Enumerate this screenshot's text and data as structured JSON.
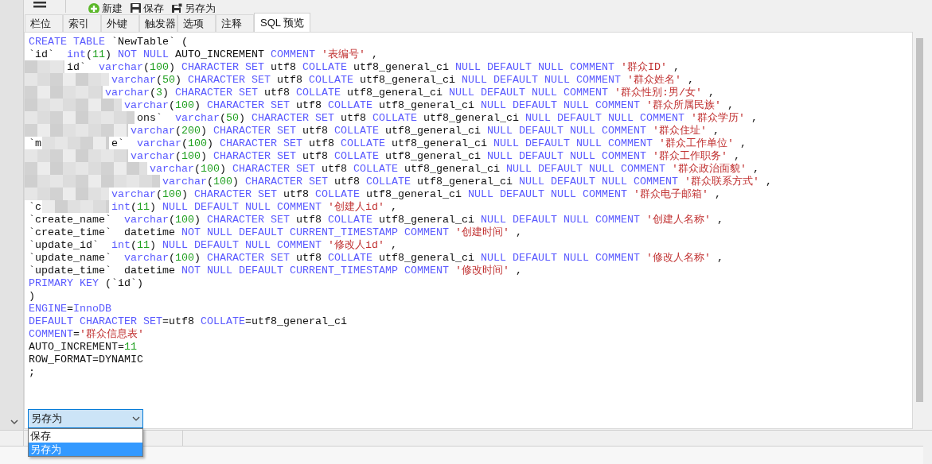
{
  "toolbar": {
    "items": [
      {
        "label": "新建",
        "kind": "new"
      },
      {
        "label": "保存",
        "kind": "save"
      },
      {
        "label": "另存为",
        "kind": "saveas"
      }
    ]
  },
  "tabs": [
    {
      "label": "栏位",
      "selected": false
    },
    {
      "label": "索引",
      "selected": false
    },
    {
      "label": "外键",
      "selected": false
    },
    {
      "label": "触发器",
      "selected": false
    },
    {
      "label": "选项",
      "selected": false
    },
    {
      "label": "注释",
      "selected": false
    },
    {
      "label": "SQL 预览",
      "selected": true
    }
  ],
  "sql_lines": [
    {
      "tokens": [
        {
          "kind": "kw",
          "text": "CREATE TABLE"
        },
        {
          "kind": "id",
          "text": " `NewTable` ("
        }
      ]
    },
    {
      "tokens": [
        {
          "kind": "id",
          "text": "`id`  "
        },
        {
          "kind": "kw",
          "text": "int"
        },
        {
          "kind": "id",
          "text": "("
        },
        {
          "kind": "num",
          "text": "11"
        },
        {
          "kind": "id",
          "text": ") "
        },
        {
          "kind": "kw",
          "text": "NOT NULL"
        },
        {
          "kind": "id",
          "text": " AUTO_INCREMENT "
        },
        {
          "kind": "kw",
          "text": "COMMENT"
        },
        {
          "kind": "str",
          "text": " '表编号'"
        },
        {
          "kind": "id",
          "text": " ,"
        }
      ]
    },
    {
      "tokens": [
        {
          "kind": "id",
          "text": "id`  "
        },
        {
          "kind": "kw",
          "text": "varchar"
        },
        {
          "kind": "id",
          "text": "("
        },
        {
          "kind": "num",
          "text": "100"
        },
        {
          "kind": "id",
          "text": ") "
        },
        {
          "kind": "kw",
          "text": "CHARACTER SET"
        },
        {
          "kind": "id",
          "text": " utf8 "
        },
        {
          "kind": "kw",
          "text": "COLLATE"
        },
        {
          "kind": "id",
          "text": " utf8_general_ci "
        },
        {
          "kind": "kw",
          "text": "NULL DEFAULT NULL COMMENT"
        },
        {
          "kind": "str",
          "text": " '群众ID'"
        },
        {
          "kind": "id",
          "text": " ,"
        }
      ]
    },
    {
      "tokens": [
        {
          "kind": "kw",
          "text": "varchar"
        },
        {
          "kind": "id",
          "text": "("
        },
        {
          "kind": "num",
          "text": "50"
        },
        {
          "kind": "id",
          "text": ") "
        },
        {
          "kind": "kw",
          "text": "CHARACTER SET"
        },
        {
          "kind": "id",
          "text": " utf8 "
        },
        {
          "kind": "kw",
          "text": "COLLATE"
        },
        {
          "kind": "id",
          "text": " utf8_general_ci "
        },
        {
          "kind": "kw",
          "text": "NULL DEFAULT NULL COMMENT"
        },
        {
          "kind": "str",
          "text": " '群众姓名'"
        },
        {
          "kind": "id",
          "text": " ,"
        }
      ]
    },
    {
      "tokens": [
        {
          "kind": "kw",
          "text": "varchar"
        },
        {
          "kind": "id",
          "text": "("
        },
        {
          "kind": "num",
          "text": "3"
        },
        {
          "kind": "id",
          "text": ") "
        },
        {
          "kind": "kw",
          "text": "CHARACTER SET"
        },
        {
          "kind": "id",
          "text": " utf8 "
        },
        {
          "kind": "kw",
          "text": "COLLATE"
        },
        {
          "kind": "id",
          "text": " utf8_general_ci "
        },
        {
          "kind": "kw",
          "text": "NULL DEFAULT NULL COMMENT"
        },
        {
          "kind": "str",
          "text": " '群众性别:男/女'"
        },
        {
          "kind": "id",
          "text": " ,"
        }
      ]
    },
    {
      "tokens": [
        {
          "kind": "kw",
          "text": "varchar"
        },
        {
          "kind": "id",
          "text": "("
        },
        {
          "kind": "num",
          "text": "100"
        },
        {
          "kind": "id",
          "text": ") "
        },
        {
          "kind": "kw",
          "text": "CHARACTER SET"
        },
        {
          "kind": "id",
          "text": " utf8 "
        },
        {
          "kind": "kw",
          "text": "COLLATE"
        },
        {
          "kind": "id",
          "text": " utf8_general_ci "
        },
        {
          "kind": "kw",
          "text": "NULL DEFAULT NULL COMMENT"
        },
        {
          "kind": "str",
          "text": " '群众所属民族'"
        },
        {
          "kind": "id",
          "text": " ,"
        }
      ]
    },
    {
      "tokens": [
        {
          "kind": "id",
          "text": "ons`  "
        },
        {
          "kind": "kw",
          "text": "varchar"
        },
        {
          "kind": "id",
          "text": "("
        },
        {
          "kind": "num",
          "text": "50"
        },
        {
          "kind": "id",
          "text": ") "
        },
        {
          "kind": "kw",
          "text": "CHARACTER SET"
        },
        {
          "kind": "id",
          "text": " utf8 "
        },
        {
          "kind": "kw",
          "text": "COLLATE"
        },
        {
          "kind": "id",
          "text": " utf8_general_ci "
        },
        {
          "kind": "kw",
          "text": "NULL DEFAULT NULL COMMENT"
        },
        {
          "kind": "str",
          "text": " '群众学历'"
        },
        {
          "kind": "id",
          "text": " ,"
        }
      ]
    },
    {
      "tokens": [
        {
          "kind": "kw",
          "text": "varchar"
        },
        {
          "kind": "id",
          "text": "("
        },
        {
          "kind": "num",
          "text": "200"
        },
        {
          "kind": "id",
          "text": ") "
        },
        {
          "kind": "kw",
          "text": "CHARACTER SET"
        },
        {
          "kind": "id",
          "text": " utf8 "
        },
        {
          "kind": "kw",
          "text": "COLLATE"
        },
        {
          "kind": "id",
          "text": " utf8_general_ci "
        },
        {
          "kind": "kw",
          "text": "NULL DEFAULT NULL COMMENT"
        },
        {
          "kind": "str",
          "text": " '群众住址'"
        },
        {
          "kind": "id",
          "text": " ,"
        }
      ]
    },
    {
      "lead": [
        {
          "kind": "id",
          "text": "`m"
        }
      ],
      "tokens": [
        {
          "kind": "id",
          "text": "e`  "
        },
        {
          "kind": "kw",
          "text": "varchar"
        },
        {
          "kind": "id",
          "text": "("
        },
        {
          "kind": "num",
          "text": "100"
        },
        {
          "kind": "id",
          "text": ") "
        },
        {
          "kind": "kw",
          "text": "CHARACTER SET"
        },
        {
          "kind": "id",
          "text": " utf8 "
        },
        {
          "kind": "kw",
          "text": "COLLATE"
        },
        {
          "kind": "id",
          "text": " utf8_general_ci "
        },
        {
          "kind": "kw",
          "text": "NULL DEFAULT NULL COMMENT"
        },
        {
          "kind": "str",
          "text": " '群众工作单位'"
        },
        {
          "kind": "id",
          "text": " ,"
        }
      ]
    },
    {
      "tokens": [
        {
          "kind": "kw",
          "text": "varchar"
        },
        {
          "kind": "id",
          "text": "("
        },
        {
          "kind": "num",
          "text": "100"
        },
        {
          "kind": "id",
          "text": ") "
        },
        {
          "kind": "kw",
          "text": "CHARACTER SET"
        },
        {
          "kind": "id",
          "text": " utf8 "
        },
        {
          "kind": "kw",
          "text": "COLLATE"
        },
        {
          "kind": "id",
          "text": " utf8_general_ci "
        },
        {
          "kind": "kw",
          "text": "NULL DEFAULT NULL COMMENT"
        },
        {
          "kind": "str",
          "text": " '群众工作职务'"
        },
        {
          "kind": "id",
          "text": " ,"
        }
      ]
    },
    {
      "tokens": [
        {
          "kind": "kw",
          "text": "varchar"
        },
        {
          "kind": "id",
          "text": "("
        },
        {
          "kind": "num",
          "text": "100"
        },
        {
          "kind": "id",
          "text": ") "
        },
        {
          "kind": "kw",
          "text": "CHARACTER SET"
        },
        {
          "kind": "id",
          "text": " utf8 "
        },
        {
          "kind": "kw",
          "text": "COLLATE"
        },
        {
          "kind": "id",
          "text": " utf8_general_ci "
        },
        {
          "kind": "kw",
          "text": "NULL DEFAULT NULL COMMENT"
        },
        {
          "kind": "str",
          "text": " '群众政治面貌'"
        },
        {
          "kind": "id",
          "text": " ,"
        }
      ]
    },
    {
      "tokens": [
        {
          "kind": "kw",
          "text": "varchar"
        },
        {
          "kind": "id",
          "text": "("
        },
        {
          "kind": "num",
          "text": "100"
        },
        {
          "kind": "id",
          "text": ") "
        },
        {
          "kind": "kw",
          "text": "CHARACTER SET"
        },
        {
          "kind": "id",
          "text": " utf8 "
        },
        {
          "kind": "kw",
          "text": "COLLATE"
        },
        {
          "kind": "id",
          "text": " utf8_general_ci "
        },
        {
          "kind": "kw",
          "text": "NULL DEFAULT NULL COMMENT"
        },
        {
          "kind": "str",
          "text": " '群众联系方式'"
        },
        {
          "kind": "id",
          "text": " ,"
        }
      ]
    },
    {
      "tokens": [
        {
          "kind": "kw",
          "text": "varchar"
        },
        {
          "kind": "id",
          "text": "("
        },
        {
          "kind": "num",
          "text": "100"
        },
        {
          "kind": "id",
          "text": ") "
        },
        {
          "kind": "kw",
          "text": "CHARACTER SET"
        },
        {
          "kind": "id",
          "text": " utf8 "
        },
        {
          "kind": "kw",
          "text": "COLLATE"
        },
        {
          "kind": "id",
          "text": " utf8_general_ci "
        },
        {
          "kind": "kw",
          "text": "NULL DEFAULT NULL COMMENT"
        },
        {
          "kind": "str",
          "text": " '群众电子邮箱'"
        },
        {
          "kind": "id",
          "text": " ,"
        }
      ]
    },
    {
      "lead": [
        {
          "kind": "id",
          "text": "`c"
        }
      ],
      "tokens": [
        {
          "kind": "kw",
          "text": "int"
        },
        {
          "kind": "id",
          "text": "("
        },
        {
          "kind": "num",
          "text": "11"
        },
        {
          "kind": "id",
          "text": ") "
        },
        {
          "kind": "kw",
          "text": "NULL DEFAULT NULL COMMENT"
        },
        {
          "kind": "str",
          "text": " '创建人id'"
        },
        {
          "kind": "id",
          "text": " ,"
        }
      ]
    },
    {
      "tokens": [
        {
          "kind": "id",
          "text": "`create_name`  "
        },
        {
          "kind": "kw",
          "text": "varchar"
        },
        {
          "kind": "id",
          "text": "("
        },
        {
          "kind": "num",
          "text": "100"
        },
        {
          "kind": "id",
          "text": ") "
        },
        {
          "kind": "kw",
          "text": "CHARACTER SET"
        },
        {
          "kind": "id",
          "text": " utf8 "
        },
        {
          "kind": "kw",
          "text": "COLLATE"
        },
        {
          "kind": "id",
          "text": " utf8_general_ci "
        },
        {
          "kind": "kw",
          "text": "NULL DEFAULT NULL COMMENT"
        },
        {
          "kind": "str",
          "text": " '创建人名称'"
        },
        {
          "kind": "id",
          "text": " ,"
        }
      ]
    },
    {
      "tokens": [
        {
          "kind": "id",
          "text": "`create_time`  datetime "
        },
        {
          "kind": "kw",
          "text": "NOT NULL DEFAULT CURRENT_TIMESTAMP COMMENT"
        },
        {
          "kind": "str",
          "text": " '创建时间'"
        },
        {
          "kind": "id",
          "text": " ,"
        }
      ]
    },
    {
      "tokens": [
        {
          "kind": "id",
          "text": "`update_id`  "
        },
        {
          "kind": "kw",
          "text": "int"
        },
        {
          "kind": "id",
          "text": "("
        },
        {
          "kind": "num",
          "text": "11"
        },
        {
          "kind": "id",
          "text": ") "
        },
        {
          "kind": "kw",
          "text": "NULL DEFAULT NULL COMMENT"
        },
        {
          "kind": "str",
          "text": " '修改人id'"
        },
        {
          "kind": "id",
          "text": " ,"
        }
      ]
    },
    {
      "tokens": [
        {
          "kind": "id",
          "text": "`update_name`  "
        },
        {
          "kind": "kw",
          "text": "varchar"
        },
        {
          "kind": "id",
          "text": "("
        },
        {
          "kind": "num",
          "text": "100"
        },
        {
          "kind": "id",
          "text": ") "
        },
        {
          "kind": "kw",
          "text": "CHARACTER SET"
        },
        {
          "kind": "id",
          "text": " utf8 "
        },
        {
          "kind": "kw",
          "text": "COLLATE"
        },
        {
          "kind": "id",
          "text": " utf8_general_ci "
        },
        {
          "kind": "kw",
          "text": "NULL DEFAULT NULL COMMENT"
        },
        {
          "kind": "str",
          "text": " '修改人名称'"
        },
        {
          "kind": "id",
          "text": " ,"
        }
      ]
    },
    {
      "tokens": [
        {
          "kind": "id",
          "text": "`update_time`  datetime "
        },
        {
          "kind": "kw",
          "text": "NOT NULL DEFAULT CURRENT_TIMESTAMP COMMENT"
        },
        {
          "kind": "str",
          "text": " '修改时间'"
        },
        {
          "kind": "id",
          "text": " ,"
        }
      ]
    },
    {
      "tokens": [
        {
          "kind": "kw",
          "text": "PRIMARY KEY"
        },
        {
          "kind": "id",
          "text": " (`id`)"
        }
      ]
    },
    {
      "tokens": [
        {
          "kind": "id",
          "text": ")"
        }
      ]
    },
    {
      "tokens": [
        {
          "kind": "kw",
          "text": "ENGINE"
        },
        {
          "kind": "id",
          "text": "="
        },
        {
          "kind": "kw",
          "text": "InnoDB"
        }
      ]
    },
    {
      "tokens": [
        {
          "kind": "kw",
          "text": "DEFAULT CHARACTER SET"
        },
        {
          "kind": "id",
          "text": "=utf8 "
        },
        {
          "kind": "kw",
          "text": "COLLATE"
        },
        {
          "kind": "id",
          "text": "=utf8_general_ci"
        }
      ]
    },
    {
      "tokens": [
        {
          "kind": "kw",
          "text": "COMMENT"
        },
        {
          "kind": "id",
          "text": "="
        },
        {
          "kind": "str",
          "text": "'群众信息表'"
        }
      ]
    },
    {
      "tokens": [
        {
          "kind": "id",
          "text": "AUTO_INCREMENT="
        },
        {
          "kind": "num",
          "text": "11"
        }
      ]
    },
    {
      "tokens": [
        {
          "kind": "id",
          "text": "ROW_FORMAT=DYNAMIC"
        }
      ]
    },
    {
      "tokens": [
        {
          "kind": "id",
          "text": ";"
        }
      ]
    }
  ],
  "save_dropdown": {
    "value": "另存为",
    "options": [
      {
        "label": "保存",
        "selected": false
      },
      {
        "label": "另存为",
        "selected": true
      }
    ]
  }
}
